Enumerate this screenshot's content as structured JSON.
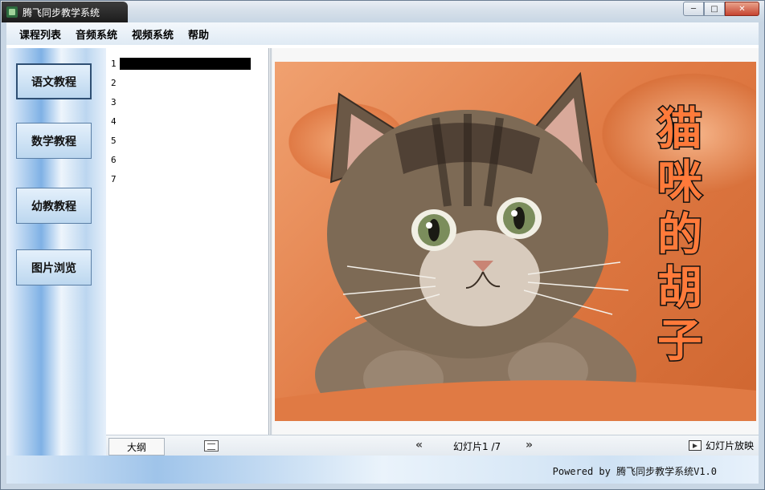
{
  "window": {
    "title": "腾飞同步教学系统",
    "controls": {
      "minimize": "─",
      "maximize": "□",
      "close": "✕"
    }
  },
  "menu": [
    "课程列表",
    "音频系统",
    "视频系统",
    "帮助"
  ],
  "nav": [
    "语文教程",
    "数学教程",
    "幼教教程",
    "图片浏览"
  ],
  "outline": {
    "rows": [
      "1",
      "2",
      "3",
      "4",
      "5",
      "6",
      "7"
    ],
    "selected_index": 0
  },
  "slide": {
    "text_chars": [
      "猫",
      "咪",
      "的",
      "胡",
      "子"
    ]
  },
  "toolbar": {
    "outline_tab": "大纲",
    "prev": "«",
    "counter": "幻灯片1 /7",
    "next": "»",
    "show_label": "幻灯片放映"
  },
  "status": {
    "powered": "Powered by 腾飞同步教学系统V1.0"
  },
  "colors": {
    "menu_bg": "#dfeaf4",
    "nav_btn_bg": "#bcd7ef",
    "slide_text": "#ff7a3a"
  },
  "icons": {
    "app": "app-icon",
    "slides_view": "slides-view-icon",
    "slideshow": "slideshow-icon"
  }
}
